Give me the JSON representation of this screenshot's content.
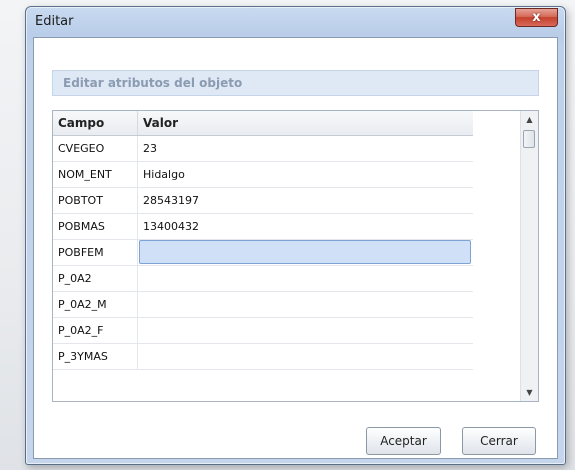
{
  "window": {
    "title": "Editar",
    "close_label": "x"
  },
  "group": {
    "title": "Editar atributos del objeto"
  },
  "grid": {
    "headers": {
      "campo": "Campo",
      "valor": "Valor"
    },
    "rows": [
      {
        "campo": "CVEGEO",
        "valor": "23"
      },
      {
        "campo": "NOM_ENT",
        "valor": "Hidalgo"
      },
      {
        "campo": "POBTOT",
        "valor": "28543197"
      },
      {
        "campo": "POBMAS",
        "valor": "13400432"
      },
      {
        "campo": "POBFEM",
        "valor": ""
      },
      {
        "campo": "P_0A2",
        "valor": ""
      },
      {
        "campo": "P_0A2_M",
        "valor": ""
      },
      {
        "campo": "P_0A2_F",
        "valor": ""
      },
      {
        "campo": "P_3YMAS",
        "valor": ""
      }
    ],
    "scroll_up_icon": "triangle-up",
    "scroll_down_icon": "triangle-down"
  },
  "buttons": {
    "accept": "Aceptar",
    "close": "Cerrar"
  }
}
